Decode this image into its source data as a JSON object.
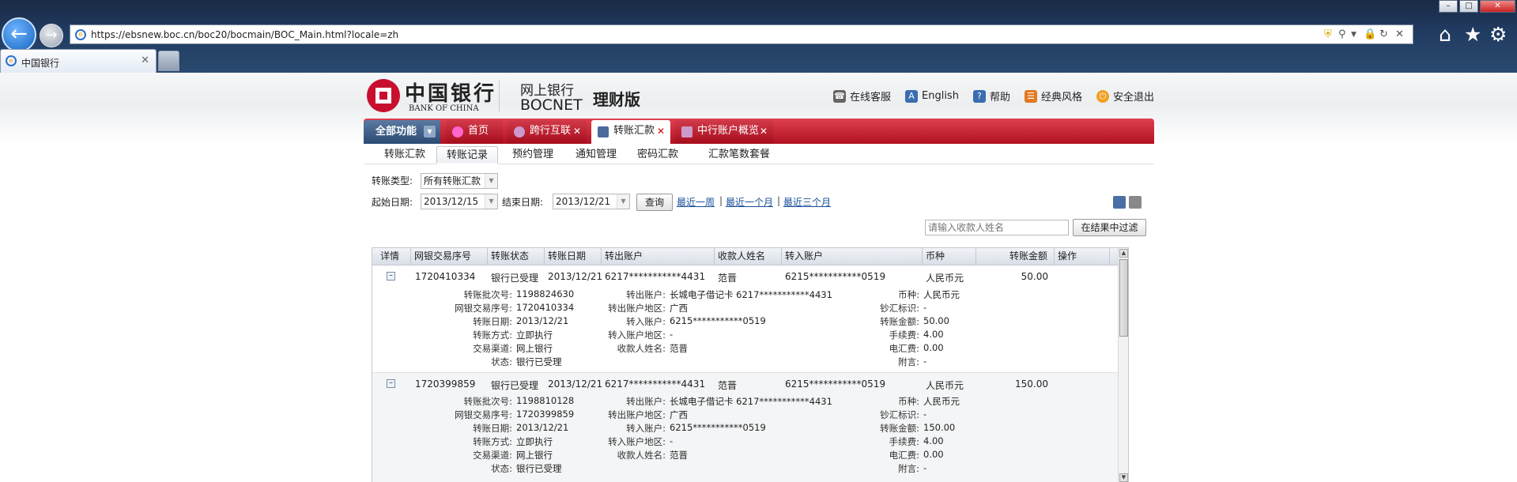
{
  "browser": {
    "url": "https://ebsnew.boc.cn/boc20/bocmain/BOC_Main.html?locale=zh",
    "tab_title": "中国银行",
    "window_controls": [
      "minimize-icon",
      "maximize-icon",
      "close-icon"
    ]
  },
  "header": {
    "logo_cn": "中国银行",
    "logo_en": "BANK OF CHINA",
    "brand_cn": "网上银行",
    "brand_en": "BOCNET",
    "edition": "理财版",
    "links": [
      {
        "label": "在线客服",
        "icon": "headset-icon",
        "color": "#555555"
      },
      {
        "label": "English",
        "icon": "language-icon",
        "color": "#3a6db0"
      },
      {
        "label": "帮助",
        "icon": "help-icon",
        "color": "#3a6db0"
      },
      {
        "label": "经典风格",
        "icon": "style-icon",
        "color": "#e07a20"
      },
      {
        "label": "安全退出",
        "icon": "logout-icon",
        "color": "#f0a020"
      }
    ]
  },
  "nav": {
    "all_functions": "全部功能",
    "tabs": [
      {
        "label": "首页"
      },
      {
        "label": "跨行互联"
      },
      {
        "label": "转账汇款"
      },
      {
        "label": "中行账户概览"
      }
    ]
  },
  "subnav": [
    "转账汇款",
    "转账记录",
    "预约管理",
    "通知管理",
    "密码汇款",
    "汇款笔数套餐"
  ],
  "filters": {
    "type_label": "转账类型:",
    "type_value": "所有转账汇款",
    "start_label": "起始日期:",
    "start_value": "2013/12/15",
    "end_label": "结束日期:",
    "end_value": "2013/12/21",
    "query_button": "查询",
    "quick_links": [
      "最近一周",
      "最近一个月",
      "最近三个月"
    ],
    "separator": "|",
    "search_placeholder": "请输入收款人姓名",
    "filter_button": "在结果中过滤"
  },
  "table": {
    "columns": [
      "详情",
      "网银交易序号",
      "转账状态",
      "转账日期",
      "转出账户",
      "收款人姓名",
      "转入账户",
      "币种",
      "转账金额",
      "操作"
    ],
    "rows": [
      {
        "seq": "1720410334",
        "status": "银行已受理",
        "date": "2013/12/21",
        "from_account": "6217***********4431",
        "payee": "范晋",
        "to_account": "6215***********0519",
        "currency": "人民币元",
        "amount": "50.00",
        "detail": {
          "c1": [
            {
              "k": "转账批次号:",
              "v": "1198824630"
            },
            {
              "k": "网银交易序号:",
              "v": "1720410334"
            },
            {
              "k": "转账日期:",
              "v": "2013/12/21"
            },
            {
              "k": "转账方式:",
              "v": "立即执行"
            },
            {
              "k": "交易渠道:",
              "v": "网上银行"
            },
            {
              "k": "状态:",
              "v": "银行已受理"
            }
          ],
          "c2": [
            {
              "k": "转出账户:",
              "v": "长城电子借记卡 6217***********4431"
            },
            {
              "k": "转出账户地区:",
              "v": "广西"
            },
            {
              "k": "转入账户:",
              "v": "6215***********0519"
            },
            {
              "k": "转入账户地区:",
              "v": "-"
            },
            {
              "k": "收款人姓名:",
              "v": "范晋"
            }
          ],
          "c3": [
            {
              "k": "币种:",
              "v": "人民币元"
            },
            {
              "k": "钞汇标识:",
              "v": "-"
            },
            {
              "k": "转账金额:",
              "v": "50.00"
            },
            {
              "k": "手续费:",
              "v": "4.00"
            },
            {
              "k": "电汇费:",
              "v": "0.00"
            },
            {
              "k": "附言:",
              "v": "-"
            }
          ]
        }
      },
      {
        "seq": "1720399859",
        "status": "银行已受理",
        "date": "2013/12/21",
        "from_account": "6217***********4431",
        "payee": "范晋",
        "to_account": "6215***********0519",
        "currency": "人民币元",
        "amount": "150.00",
        "detail": {
          "c1": [
            {
              "k": "转账批次号:",
              "v": "1198810128"
            },
            {
              "k": "网银交易序号:",
              "v": "1720399859"
            },
            {
              "k": "转账日期:",
              "v": "2013/12/21"
            },
            {
              "k": "转账方式:",
              "v": "立即执行"
            },
            {
              "k": "交易渠道:",
              "v": "网上银行"
            },
            {
              "k": "状态:",
              "v": "银行已受理"
            }
          ],
          "c2": [
            {
              "k": "转出账户:",
              "v": "长城电子借记卡 6217***********4431"
            },
            {
              "k": "转出账户地区:",
              "v": "广西"
            },
            {
              "k": "转入账户:",
              "v": "6215***********0519"
            },
            {
              "k": "转入账户地区:",
              "v": "-"
            },
            {
              "k": "收款人姓名:",
              "v": "范晋"
            }
          ],
          "c3": [
            {
              "k": "币种:",
              "v": "人民币元"
            },
            {
              "k": "钞汇标识:",
              "v": "-"
            },
            {
              "k": "转账金额:",
              "v": "150.00"
            },
            {
              "k": "手续费:",
              "v": "4.00"
            },
            {
              "k": "电汇费:",
              "v": "0.00"
            },
            {
              "k": "附言:",
              "v": "-"
            }
          ]
        }
      }
    ]
  },
  "colors": {
    "brand_red": "#c8102e",
    "link_blue": "#1a4f9a"
  }
}
